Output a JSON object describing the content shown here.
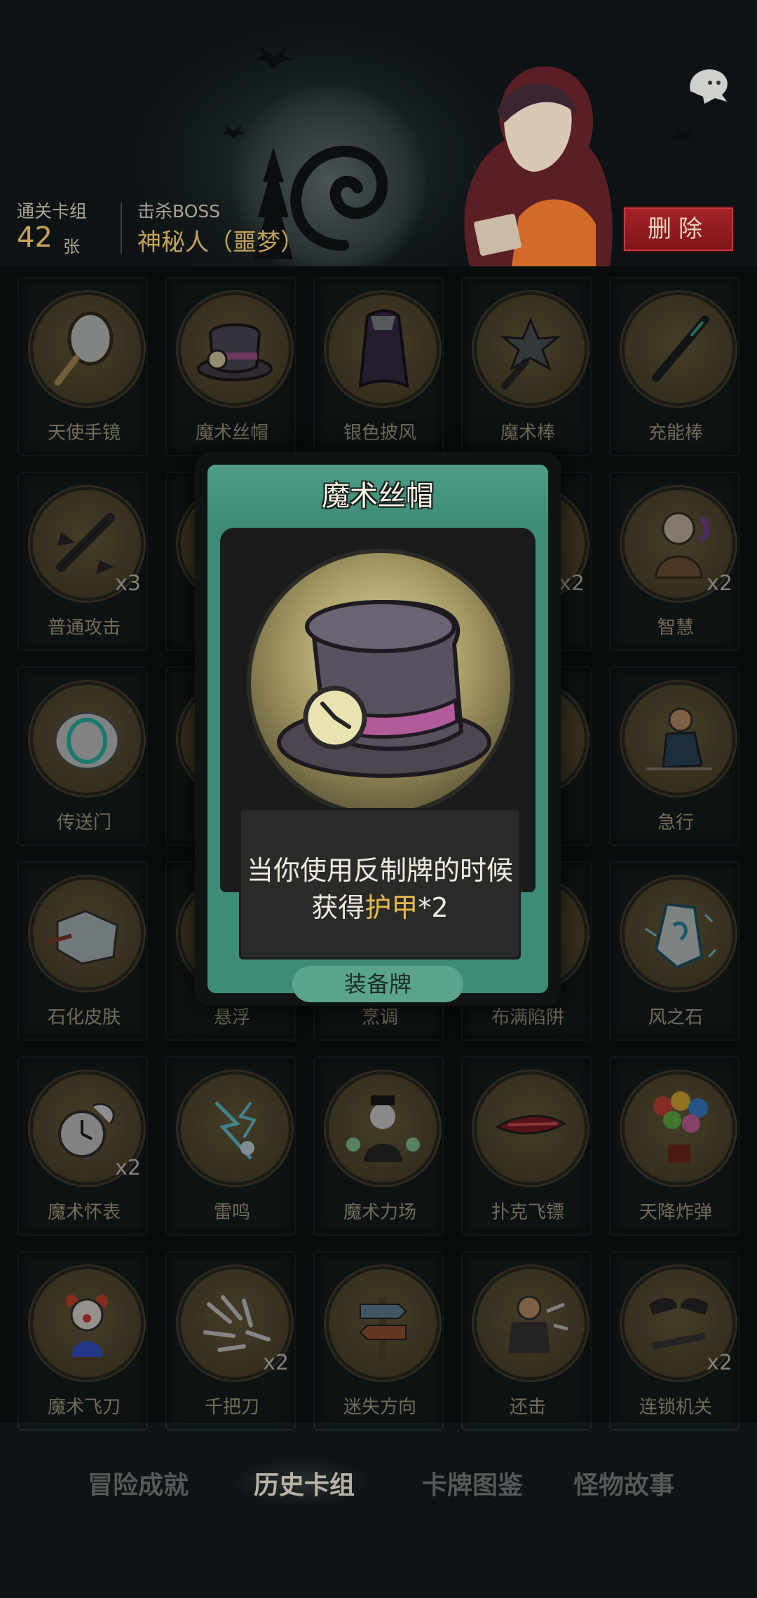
{
  "header": {
    "deck_label": "通关卡组",
    "deck_count": "42",
    "deck_unit": "张",
    "boss_label": "击杀BOSS",
    "boss_name": "神秘人（噩梦）",
    "delete_label": "删除"
  },
  "cards": [
    {
      "name": "天使手镜",
      "count": "",
      "icon": "hand-mirror-icon"
    },
    {
      "name": "魔术丝帽",
      "count": "",
      "icon": "top-hat-icon"
    },
    {
      "name": "银色披风",
      "count": "",
      "icon": "cloak-icon"
    },
    {
      "name": "魔术棒",
      "count": "",
      "icon": "magic-wand-icon"
    },
    {
      "name": "充能棒",
      "count": "",
      "icon": "charge-wand-icon"
    },
    {
      "name": "普通攻击",
      "count": "x3",
      "icon": "attack-icon"
    },
    {
      "name": "",
      "count": "",
      "icon": "hidden-card-icon"
    },
    {
      "name": "",
      "count": "",
      "icon": "hidden-card-icon"
    },
    {
      "name": "",
      "count": "x2",
      "icon": "hidden-card-icon"
    },
    {
      "name": "智慧",
      "count": "x2",
      "icon": "wisdom-icon"
    },
    {
      "name": "传送门",
      "count": "",
      "icon": "portal-icon"
    },
    {
      "name": "",
      "count": "",
      "icon": "hidden-card-icon"
    },
    {
      "name": "",
      "count": "",
      "icon": "hidden-card-icon"
    },
    {
      "name": "",
      "count": "",
      "icon": "hidden-card-icon"
    },
    {
      "name": "急行",
      "count": "",
      "icon": "dash-icon"
    },
    {
      "name": "石化皮肤",
      "count": "",
      "icon": "stone-skin-icon"
    },
    {
      "name": "悬浮",
      "count": "",
      "icon": "levitate-icon"
    },
    {
      "name": "烹调",
      "count": "",
      "icon": "cooking-icon"
    },
    {
      "name": "布满陷阱",
      "count": "",
      "icon": "trap-icon"
    },
    {
      "name": "风之石",
      "count": "",
      "icon": "wind-stone-icon"
    },
    {
      "name": "魔术怀表",
      "count": "x2",
      "icon": "pocket-watch-icon"
    },
    {
      "name": "雷鸣",
      "count": "",
      "icon": "thunder-icon"
    },
    {
      "name": "魔术力场",
      "count": "",
      "icon": "magic-field-icon"
    },
    {
      "name": "扑克飞镖",
      "count": "",
      "icon": "poker-dart-icon"
    },
    {
      "name": "天降炸弹",
      "count": "",
      "icon": "balloon-bomb-icon"
    },
    {
      "name": "魔术飞刀",
      "count": "",
      "icon": "clown-knife-icon"
    },
    {
      "name": "千把刀",
      "count": "x2",
      "icon": "thousand-blades-icon"
    },
    {
      "name": "迷失方向",
      "count": "",
      "icon": "signpost-icon"
    },
    {
      "name": "还击",
      "count": "",
      "icon": "counter-icon"
    },
    {
      "name": "连锁机关",
      "count": "x2",
      "icon": "chain-trap-icon"
    }
  ],
  "popup": {
    "title": "魔术丝帽",
    "desc_line1": "当你使用反制牌的时候",
    "desc_line2_prefix": "获得",
    "desc_line2_highlight": "护甲",
    "desc_line2_suffix": "*2",
    "type": "装备牌",
    "icon": "top-hat-icon"
  },
  "tabs": [
    {
      "label": "冒险成就",
      "active": false
    },
    {
      "label": "历史卡组",
      "active": true
    },
    {
      "label": "卡牌图鉴",
      "active": false
    },
    {
      "label": "怪物故事",
      "active": false
    }
  ],
  "colors": {
    "background": "#0e1416",
    "gold_text": "#c4a35a",
    "delete_red": "#a8222a",
    "card_teal": "#3e8b78",
    "armor_highlight": "#e6b94a"
  }
}
